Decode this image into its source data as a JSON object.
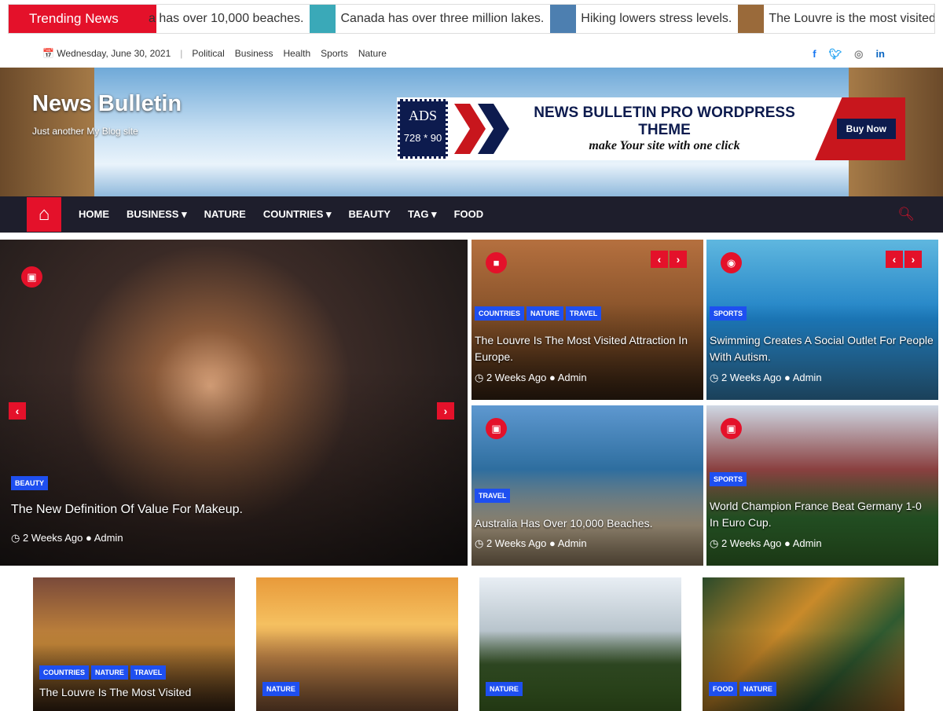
{
  "ticker": {
    "label": "Trending News",
    "items": [
      {
        "text": "a has over 10,000 beaches.",
        "thumb": ""
      },
      {
        "text": "Canada has over three million lakes.",
        "thumb": "#3aa9b8"
      },
      {
        "text": "Hiking lowers stress levels.",
        "thumb": "#4d7fb0"
      },
      {
        "text": "The Louvre is the most visited attraction",
        "thumb": "#9a6a3a"
      }
    ]
  },
  "topbar": {
    "date": "Wednesday, June 30, 2021",
    "links": [
      "Political",
      "Business",
      "Health",
      "Sports",
      "Nature"
    ],
    "social": [
      "facebook",
      "twitter",
      "instagram",
      "linkedin"
    ]
  },
  "header": {
    "title": "News Bulletin",
    "tagline": "Just another My Blog site"
  },
  "ad": {
    "label": "ADS",
    "size": "728 * 90",
    "headline": "NEWS BULLETIN PRO WORDPRESS THEME",
    "sub": "make Your site with one click",
    "cta": "Buy Now"
  },
  "nav": {
    "items": [
      "Home",
      "Business ▾",
      "Nature",
      "Countries ▾",
      "Beauty",
      "Tag ▾",
      "Food"
    ]
  },
  "colors": {
    "accent": "#e4112a",
    "badge": "#1e4ff0",
    "nav": "#1e1e2c"
  },
  "featured": {
    "cats": [
      "Beauty"
    ],
    "title": "The New Definition Of Value For Makeup.",
    "time": "2 Weeks Ago",
    "author": "Admin",
    "icon": "image-icon"
  },
  "grid": [
    {
      "cats": [
        "Countries",
        "Nature",
        "Travel"
      ],
      "title": "The Louvre Is The Most Visited Attraction In Europe.",
      "time": "2 Weeks Ago",
      "author": "Admin",
      "icon": "video-icon"
    },
    {
      "cats": [
        "Sports"
      ],
      "title": "Swimming Creates A Social Outlet For People With Autism.",
      "time": "2 Weeks Ago",
      "author": "Admin",
      "icon": "camera-icon"
    },
    {
      "cats": [
        "Travel"
      ],
      "title": "Australia Has Over 10,000 Beaches.",
      "time": "2 Weeks Ago",
      "author": "Admin",
      "icon": "image-icon"
    },
    {
      "cats": [
        "Sports"
      ],
      "title": "World Champion France Beat Germany 1-0 In Euro Cup.",
      "time": "2 Weeks Ago",
      "author": "Admin",
      "icon": "image-icon"
    }
  ],
  "bottom": [
    {
      "cats": [
        "Countries",
        "Nature",
        "Travel"
      ],
      "title": "The Louvre Is The Most Visited"
    },
    {
      "cats": [
        "Nature"
      ],
      "title": ""
    },
    {
      "cats": [
        "Nature"
      ],
      "title": ""
    },
    {
      "cats": [
        "Food",
        "Nature"
      ],
      "title": ""
    }
  ]
}
